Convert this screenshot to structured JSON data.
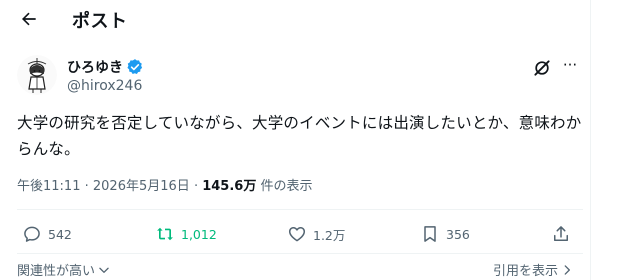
{
  "header": {
    "title": "ポスト",
    "back_icon": "arrow-left-icon"
  },
  "post": {
    "author_name": "ひろゆき",
    "handle": "@hirox246",
    "verified_icon": "verified-badge-icon",
    "text": "大学の研究を否定していながら、大学のイベントには出演したいとか、意味わからんな。",
    "time": "午後11:11",
    "separator": "·",
    "date": "2026年5月16日",
    "views_count": "145.6万",
    "views_label": "件の表示"
  },
  "actions": {
    "replies": "542",
    "reposts": "1,012",
    "likes": "1.2万",
    "bookmarks": "356"
  },
  "footer": {
    "relevance_label": "関連性が高い",
    "quotes_label": "引用を表示"
  },
  "colors": {
    "accent": "#1d9bf0",
    "repost": "#00ba7c",
    "muted": "#536471",
    "text": "#0f1419"
  }
}
